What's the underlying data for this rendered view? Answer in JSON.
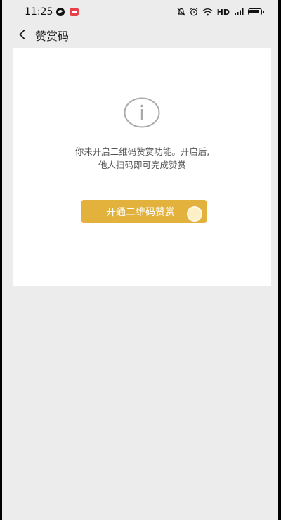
{
  "status_bar": {
    "time": "11:25",
    "network_label": "HD",
    "icons": [
      "app-notification-icon",
      "red-badge-app-icon",
      "mute-icon",
      "alarm-icon",
      "wifi-icon",
      "signal-icon",
      "battery-icon"
    ]
  },
  "header": {
    "title": "赞赏码",
    "back_icon": "chevron-left-icon"
  },
  "card": {
    "icon": "info-circle-icon",
    "message_line1": "你未开启二维码赞赏功能。开启后,",
    "message_line2": "他人扫码即可完成赞赏",
    "button_label": "开通二维码赞赏",
    "button_color": "#e3b23c"
  },
  "colors": {
    "background": "#ececec",
    "card": "#ffffff",
    "accent": "#e3b23c"
  }
}
